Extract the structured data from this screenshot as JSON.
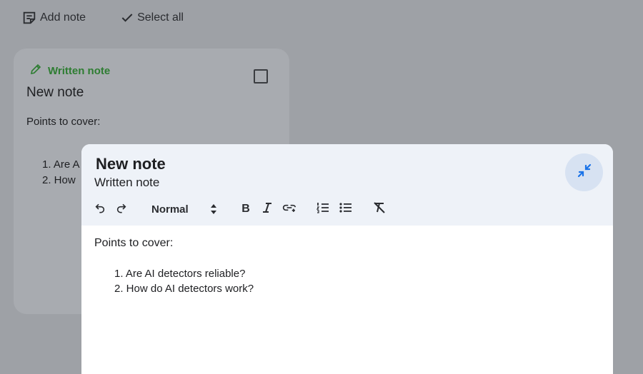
{
  "toolbar": {
    "add_note_label": "Add note",
    "select_all_label": "Select all"
  },
  "note_card": {
    "type_label": "Written note",
    "title": "New note",
    "body_intro": "Points to cover:",
    "items": [
      "1.  Are A",
      "2.  How"
    ],
    "type_color": "#2e7d32"
  },
  "editor": {
    "title": "New note",
    "subtitle": "Written note",
    "style_select_value": "Normal",
    "body_intro": "Points to cover:",
    "items": [
      "1. Are AI detectors reliable?",
      "2. How do AI detectors work?"
    ],
    "accent": "#1a73e8",
    "header_bg": "#eef2f8"
  },
  "icons": {
    "add_note": "note-add-icon",
    "select_all": "checkmark-icon",
    "edit": "pencil-icon",
    "collapse": "collapse-arrows-icon",
    "undo": "undo-icon",
    "redo": "redo-icon",
    "bold": "bold-icon",
    "italic": "italic-icon",
    "link": "link-icon",
    "numbered_list": "numbered-list-icon",
    "bulleted_list": "bulleted-list-icon",
    "clear_format": "clear-formatting-icon"
  }
}
